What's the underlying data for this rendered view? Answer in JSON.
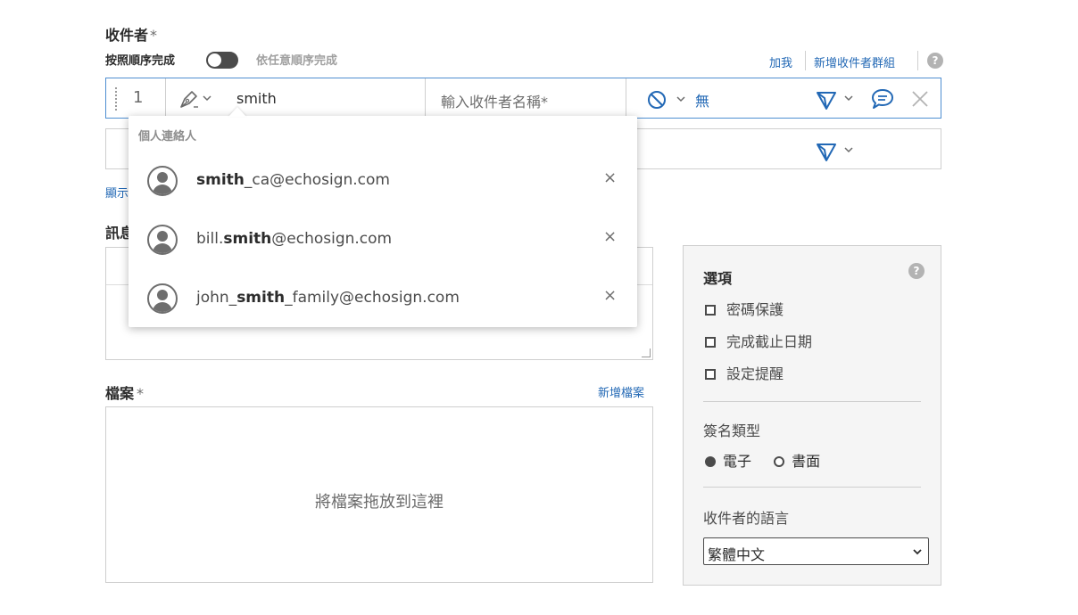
{
  "recipients": {
    "title": "收件者",
    "required_mark": "*",
    "order_label": "按照順序完成",
    "any_order_label": "依任意順序完成",
    "add_me": "加我",
    "add_group": "新增收件者群組",
    "help": "?",
    "row1": {
      "number": "1",
      "email_value": "smith",
      "name_placeholder": "輸入收件者名稱*",
      "auth_value": "無"
    },
    "show_link": "顯示"
  },
  "dropdown": {
    "header": "個人連絡人",
    "items": [
      {
        "pre": "",
        "match": "smith",
        "post": "_ca@echosign.com",
        "remove": "×"
      },
      {
        "pre": "bill.",
        "match": "smith",
        "post": "@echosign.com",
        "remove": "×"
      },
      {
        "pre": "john_",
        "match": "smith",
        "post": "_family@echosign.com",
        "remove": "×"
      }
    ]
  },
  "message": {
    "label": "訊息"
  },
  "files": {
    "label": "檔案",
    "required_mark": "*",
    "add_file": "新增檔案",
    "drop_text": "將檔案拖放到這裡"
  },
  "options": {
    "title": "選項",
    "help": "?",
    "checkboxes": [
      "密碼保護",
      "完成截止日期",
      "設定提醒"
    ],
    "signature_type_title": "簽名類型",
    "signature_types": [
      "電子",
      "書面"
    ],
    "language_title": "收件者的語言",
    "language_value": "繁體中文"
  },
  "colors": {
    "accent": "#2268b5",
    "row_active_border": "#4f8fd1",
    "toggle": "#4b4b4b",
    "panel_bg": "#f5f5f5"
  },
  "icons": {
    "signer_role": "pen-icon",
    "auth": "no-auth-icon",
    "delivery": "send-icon",
    "private_message": "chat-icon",
    "delete": "close-icon"
  }
}
